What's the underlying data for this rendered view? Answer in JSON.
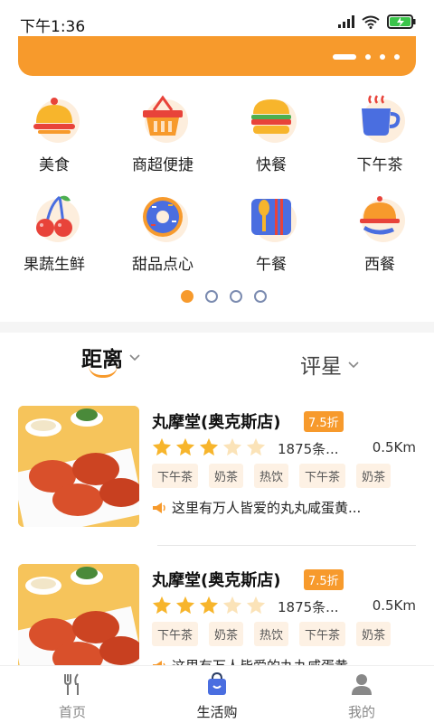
{
  "status_bar": {
    "time": "下午1:36",
    "icons": [
      "signal-icon",
      "wifi-icon",
      "battery-charging-icon"
    ]
  },
  "colors": {
    "accent": "#f79a2c",
    "tag_bg": "#fdf1e4",
    "separator": "#f5f5f5"
  },
  "categories": [
    {
      "label": "美食",
      "icon": "dish-cloche-icon"
    },
    {
      "label": "商超便捷",
      "icon": "basket-icon"
    },
    {
      "label": "快餐",
      "icon": "burger-icon"
    },
    {
      "label": "下午茶",
      "icon": "coffee-cup-icon"
    },
    {
      "label": "果蔬生鲜",
      "icon": "cherry-icon"
    },
    {
      "label": "甜品点心",
      "icon": "donut-icon"
    },
    {
      "label": "午餐",
      "icon": "cutlery-icon"
    },
    {
      "label": "西餐",
      "icon": "serving-tray-icon"
    }
  ],
  "category_pager": {
    "pages": 4,
    "current": 1
  },
  "sort": {
    "distance_label": "距离",
    "rating_label": "评星"
  },
  "shops": [
    {
      "name": "丸摩堂(奥克斯店)",
      "discount": "7.5折",
      "rating": 3,
      "max_rating": 5,
      "reviews": "1875条...",
      "distance": "0.5Km",
      "tags": [
        "下午茶",
        "奶茶",
        "热饮",
        "下午茶",
        "奶茶"
      ],
      "promo": "这里有万人皆爱的丸丸咸蛋黄..."
    },
    {
      "name": "丸摩堂(奥克斯店)",
      "discount": "7.5折",
      "rating": 3,
      "max_rating": 5,
      "reviews": "1875条...",
      "distance": "0.5Km",
      "tags": [
        "下午茶",
        "奶茶",
        "热饮",
        "下午茶",
        "奶茶"
      ],
      "promo": "这里有万人皆爱的丸丸咸蛋黄..."
    }
  ],
  "bottom_nav": [
    {
      "label": "首页",
      "icon": "fork-knife-icon"
    },
    {
      "label": "生活购",
      "icon": "shopping-bag-icon",
      "active": true
    },
    {
      "label": "我的",
      "icon": "user-icon"
    }
  ]
}
